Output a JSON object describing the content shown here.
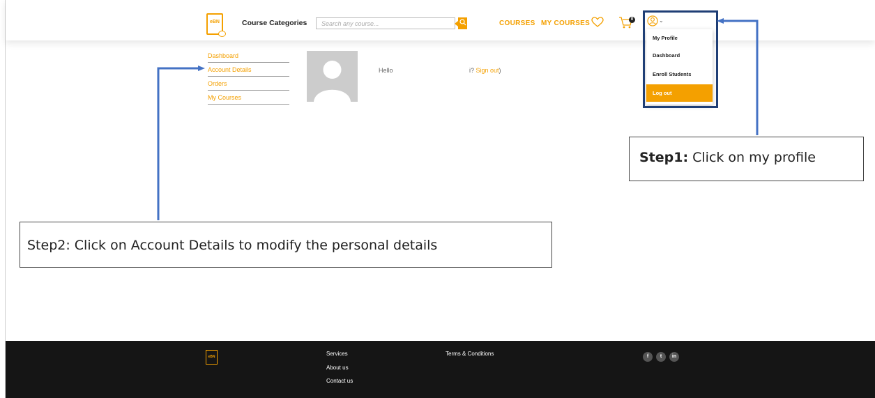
{
  "header": {
    "logo_text": "eBN",
    "course_categories": "Course Categories",
    "search_placeholder": "Search any course...",
    "nav": {
      "courses": "COURSES",
      "my_courses": "MY COURSES"
    },
    "cart_count": "0"
  },
  "dropdown": {
    "items": [
      "My Profile",
      "Dashboard",
      "Enroll Students",
      "Log out"
    ],
    "active_item": "Log out"
  },
  "account_menu": {
    "items": [
      "Dashboard",
      "Account Details",
      "Orders",
      "My Courses"
    ]
  },
  "greeting": {
    "hello": "Hello",
    "signout_prefix": "i? ",
    "signout_link": "Sign out",
    "signout_suffix": ")"
  },
  "annotations": {
    "step1_bold": "Step1:",
    "step1_text": " Click on my profile",
    "step2_text": "Step2: Click on Account Details to modify the personal details"
  },
  "footer": {
    "logo_text": "eBN",
    "links_col1": [
      "Services",
      "About us",
      "Contact us"
    ],
    "links_col2": [
      "Terms & Conditions"
    ],
    "social": [
      "f",
      "t",
      "in"
    ]
  },
  "colors": {
    "brand_orange": "#f4a000",
    "annotation_blue": "#4472c4",
    "annotation_box": "#1f3e75",
    "footer_bg": "#151515"
  }
}
